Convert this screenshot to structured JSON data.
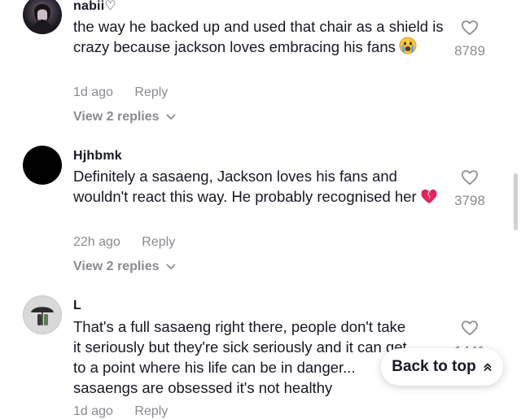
{
  "comments": [
    {
      "username": "nabii♡",
      "text": "the way he backed up and used that chair as a shield is crazy because jackson loves embracing his fans",
      "emoji_icon": "crying-face-emoji",
      "time": "1d ago",
      "reply_label": "Reply",
      "view_replies": "View 2 replies",
      "likes": "8789"
    },
    {
      "username": "Hjhbmk",
      "text": "Definitely a sasaeng, Jackson loves his fans and wouldn't react this way. He probably recognised her",
      "emoji_icon": "broken-heart-emoji",
      "time": "22h ago",
      "reply_label": "Reply",
      "view_replies": "View 2 replies",
      "likes": "3798"
    },
    {
      "username": "L",
      "text_lines": [
        "That's a full sasaeng right there, people don't take",
        "it seriously but they're sick seriously and it can get",
        "to a point where his life can be in danger...",
        "sasaengs are obsessed it's not healthy"
      ],
      "time": "1d ago",
      "reply_label": "Reply",
      "likes": "1441"
    }
  ],
  "back_to_top": {
    "label": "Back to top",
    "icon": "double-chevron-up-icon"
  },
  "colors": {
    "text": "#161823",
    "secondary": "#8a8b91",
    "background": "#ffffff",
    "broken_heart": "#e0245e"
  }
}
